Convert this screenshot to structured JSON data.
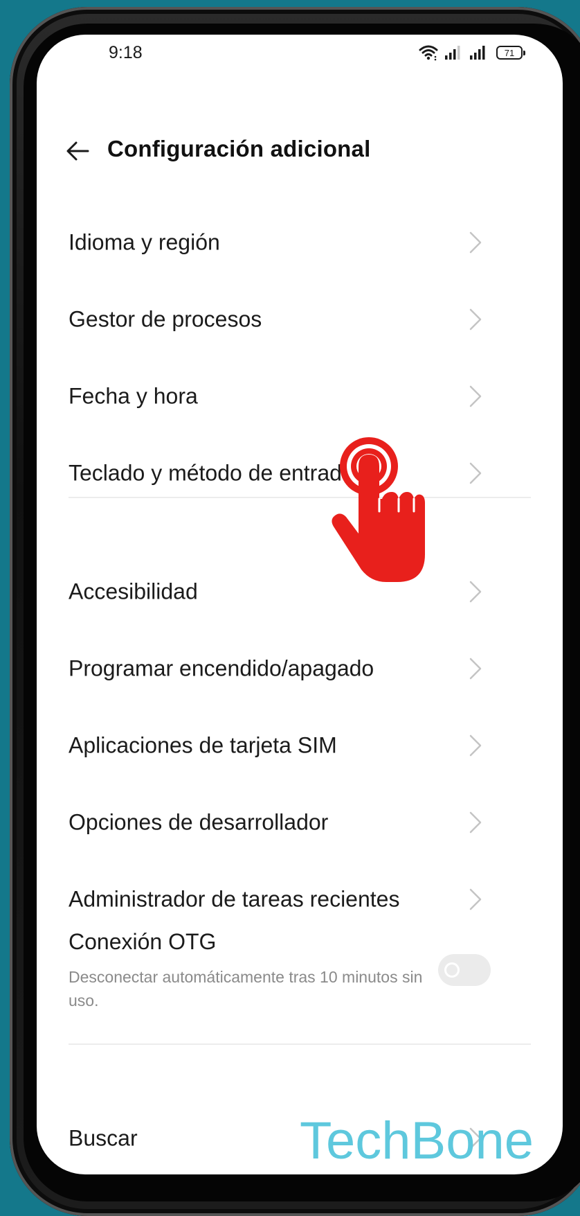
{
  "status_bar": {
    "time": "9:18",
    "battery": "71",
    "icons": [
      "wifi-icon",
      "signal-icon",
      "signal-icon",
      "battery-icon"
    ]
  },
  "header": {
    "title": "Configuración adicional",
    "back_icon": "back-arrow-icon"
  },
  "group1": [
    {
      "label": "Idioma y región"
    },
    {
      "label": "Gestor de procesos"
    },
    {
      "label": "Fecha y hora"
    },
    {
      "label": "Teclado y método de entrada"
    }
  ],
  "group2": [
    {
      "label": "Accesibilidad"
    },
    {
      "label": "Programar encendido/apagado"
    },
    {
      "label": "Aplicaciones de tarjeta SIM"
    },
    {
      "label": "Opciones de desarrollador"
    },
    {
      "label": "Administrador de tareas recientes"
    }
  ],
  "otg": {
    "title": "Conexión OTG",
    "description": "Desconectar automáticamente tras 10 minutos sin uso.",
    "enabled": false
  },
  "group3": [
    {
      "label": "Buscar"
    }
  ],
  "watermark": "TechBone",
  "colors": {
    "background": "#14788b",
    "tap_indicator": "#e8201c",
    "watermark": "#5ec8dd"
  }
}
